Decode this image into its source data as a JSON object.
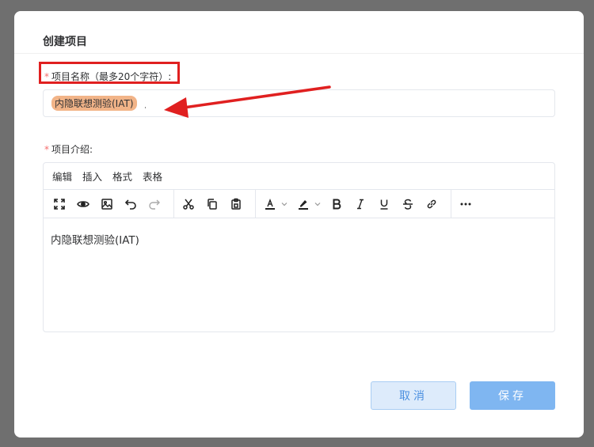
{
  "dialog": {
    "title": "创建项目",
    "name_label": "项目名称（最多20个字符）:",
    "name_required_mark": "*",
    "name_value": "内隐联想测验(IAT)",
    "intro_label": "项目介绍:",
    "intro_required_mark": "*",
    "editor": {
      "menus": [
        "编辑",
        "插入",
        "格式",
        "表格"
      ],
      "toolbar_icons": [
        "fullscreen-icon",
        "preview-eye-icon",
        "image-icon",
        "undo-icon",
        "redo-icon",
        "cut-icon",
        "copy-icon",
        "paste-icon",
        "text-color-icon",
        "highlight-color-icon",
        "bold-icon",
        "italic-icon",
        "underline-icon",
        "strikethrough-icon",
        "link-icon",
        "more-icon"
      ],
      "content": "内隐联想测验(IAT)"
    },
    "cancel_label": "取消",
    "save_label": "保存"
  },
  "annotation": {
    "highlight_color": "#e02020"
  }
}
